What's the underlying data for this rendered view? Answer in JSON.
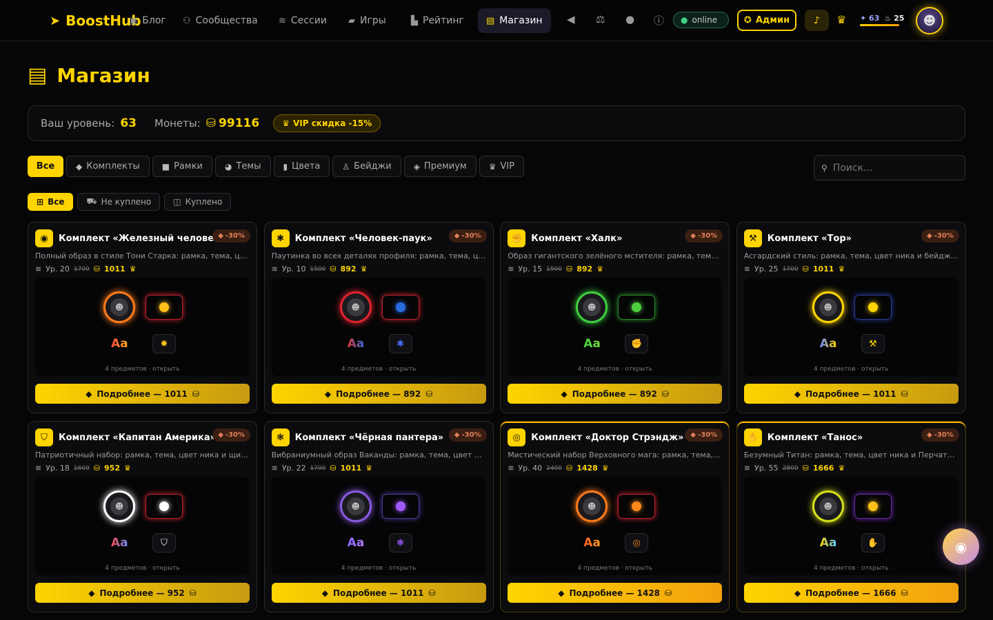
{
  "nav": {
    "logo": "BoostHub",
    "items": [
      {
        "label": "Блог",
        "icon": "blog-icon",
        "glyph": "▣"
      },
      {
        "label": "Сообщества",
        "icon": "communities-icon",
        "glyph": "⚇"
      },
      {
        "label": "Сессии",
        "icon": "sessions-icon",
        "glyph": "≋"
      },
      {
        "label": "Игры",
        "icon": "gamepad-icon",
        "glyph": "▰"
      },
      {
        "label": "Рейтинг",
        "icon": "rating-icon",
        "glyph": "▙"
      },
      {
        "label": "Магазин",
        "icon": "shop-icon",
        "glyph": "▤"
      }
    ],
    "online": "online",
    "admin": "Админ",
    "stat_a": "63",
    "stat_b": "25"
  },
  "page": {
    "title": "Магазин",
    "level_label": "Ваш уровень:",
    "level_value": "63",
    "coins_label": "Монеты:",
    "coins_value": "99116",
    "vip_label": "VIP скидка -15%"
  },
  "filters": {
    "categories": [
      {
        "label": "Все",
        "icon": ""
      },
      {
        "label": "Комплекты",
        "icon": "bundle-icon"
      },
      {
        "label": "Рамки",
        "icon": "frame-icon"
      },
      {
        "label": "Темы",
        "icon": "palette-icon"
      },
      {
        "label": "Цвета",
        "icon": "brush-icon"
      },
      {
        "label": "Бейджи",
        "icon": "badge-icon"
      },
      {
        "label": "Премиум",
        "icon": "gem-icon"
      },
      {
        "label": "VIP",
        "icon": "crown-icon"
      }
    ],
    "search_placeholder": "Поиск...",
    "status": [
      {
        "label": "Все",
        "icon": "grid-icon"
      },
      {
        "label": "Не куплено",
        "icon": "cart-icon"
      },
      {
        "label": "Куплено",
        "icon": "bag-icon"
      }
    ]
  },
  "cards": [
    {
      "name": "Комплект «Железный человек»",
      "desc": "Полный образ в стиле Тони Старка: рамка, тема, цвет...",
      "level": "Ур. 20",
      "old": "1700",
      "price": "1011",
      "discount": "-30%",
      "count": "4 предметов · открыть",
      "button": "Подробнее — 1011",
      "icon": "robot-icon",
      "glyph": "◉",
      "badge_glyph": "✹",
      "ring": "#ff7a1a",
      "theme_border": "#c0232e",
      "dot": "#ffc01a",
      "aa": "linear-gradient(90deg,#ff4a3a,#ffb01a)",
      "badge_color": "#ffc01a",
      "glow": false
    },
    {
      "name": "Комплект «Человек-паук»",
      "desc": "Паутинка во всех деталях профиля: рамка, тема, цвет...",
      "level": "Ур. 10",
      "old": "1500",
      "price": "892",
      "discount": "-30%",
      "count": "4 предметов · открыть",
      "button": "Подробнее — 892",
      "icon": "spider-icon",
      "glyph": "✱",
      "badge_glyph": "✱",
      "ring": "#e0232e",
      "theme_border": "#c0232e",
      "dot": "#2a6adf",
      "aa": "linear-gradient(90deg,#e03a3a,#3a6adf)",
      "badge_color": "#4a6aff",
      "glow": false
    },
    {
      "name": "Комплект «Халк»",
      "desc": "Образ гигантского зелёного мстителя: рамка, тема, цвет...",
      "level": "Ур. 15",
      "old": "1500",
      "price": "892",
      "discount": "-30%",
      "count": "4 предметов · открыть",
      "button": "Подробнее — 892",
      "icon": "fist-icon",
      "glyph": "✊",
      "badge_glyph": "✊",
      "ring": "#3fcf3f",
      "theme_border": "#2a8a2a",
      "dot": "#4fcf3f",
      "aa": "linear-gradient(90deg,#3fcf3f,#7adf3f)",
      "badge_color": "#4fcf3f",
      "glow": false
    },
    {
      "name": "Комплект «Тор»",
      "desc": "Асгардский стиль: рамка, тема, цвет ника и бейдж с...",
      "level": "Ур. 25",
      "old": "1700",
      "price": "1011",
      "discount": "-30%",
      "count": "4 предметов · открыть",
      "button": "Подробнее — 1011",
      "icon": "hammer-icon",
      "glyph": "⚒",
      "badge_glyph": "⚒",
      "ring": "#ffd400",
      "theme_border": "#2a3a9a",
      "dot": "#ffd400",
      "aa": "linear-gradient(90deg,#6a8aff,#ffd400)",
      "badge_color": "#ffd400",
      "glow": false
    },
    {
      "name": "Комплект «Капитан Америка»",
      "desc": "Патриотичный набор: рамка, тема, цвет ника и щит Кэпа.",
      "level": "Ур. 18",
      "old": "1600",
      "price": "952",
      "discount": "-30%",
      "count": "4 предметов · открыть",
      "button": "Подробнее — 952",
      "icon": "shield-icon",
      "glyph": "⛉",
      "badge_glyph": "⛉",
      "ring": "#ffffff",
      "theme_border": "#c0232e",
      "dot": "#ffffff",
      "aa": "linear-gradient(90deg,#ff4a4a,#6a8aff)",
      "badge_color": "#ffffff",
      "glow": false
    },
    {
      "name": "Комплект «Чёрная пантера»",
      "desc": "Вибраниумный образ Ваканды: рамка, тема, цвет ника ...",
      "level": "Ур. 22",
      "old": "1700",
      "price": "1011",
      "discount": "-30%",
      "count": "4 предметов · открыть",
      "button": "Подробнее — 1011",
      "icon": "paw-icon",
      "glyph": "❃",
      "badge_glyph": "❃",
      "ring": "#8a5adf",
      "theme_border": "#4a3a9a",
      "dot": "#a05aff",
      "aa": "linear-gradient(90deg,#8a6aff,#b07aff)",
      "badge_color": "#a05aff",
      "glow": false
    },
    {
      "name": "Комплект «Доктор Стрэндж»",
      "desc": "Мистический набор Верховного мага: рамка, тема, цвет...",
      "level": "Ур. 40",
      "old": "2400",
      "price": "1428",
      "discount": "-30%",
      "count": "4 предметов · открыть",
      "button": "Подробнее — 1428",
      "icon": "eye-icon",
      "glyph": "◎",
      "badge_glyph": "◎",
      "ring": "#ff7a1a",
      "theme_border": "#c0232e",
      "dot": "#ff8a1a",
      "aa": "linear-gradient(90deg,#ff5a2a,#ffa01a)",
      "badge_color": "#ff8a1a",
      "glow": true
    },
    {
      "name": "Комплект «Танос»",
      "desc": "Безумный Титан: рамка, тема, цвет ника и Перчатка...",
      "level": "Ур. 55",
      "old": "2800",
      "price": "1666",
      "discount": "-30%",
      "count": "4 предметов · открыть",
      "button": "Подробнее — 1666",
      "icon": "gauntlet-icon",
      "glyph": "✋",
      "badge_glyph": "✋",
      "ring": "#d4e01a",
      "theme_border": "#6a2aaa",
      "dot": "#ffc01a",
      "aa": "linear-gradient(90deg,#ffd400,#5ad0ff)",
      "badge_color": "#ffc01a",
      "glow": true
    }
  ]
}
